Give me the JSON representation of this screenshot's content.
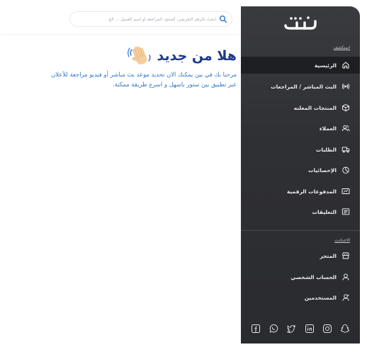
{
  "header": {
    "search_placeholder": "ابحث بالرقم التعريفي، المنتج، المراجعة أو اسم العميل ... الخ"
  },
  "welcome": {
    "title": "هلا من جديد",
    "line1": "مرحبا بك في بين يمكنك الان تحديد موعد بث مباشر أو فيديو مراجعة للأعلان",
    "line2": "عبر تطبيق بين ستور باسهل و اسرع طريقة ممكنة."
  },
  "sidebar": {
    "logo_text": "بين",
    "explore_label": "استكشف",
    "items": [
      {
        "label": "الرئيسية",
        "icon": "home-icon",
        "active": true
      },
      {
        "label": "البث المباشر / المراجعات",
        "icon": "broadcast-icon",
        "active": false
      },
      {
        "label": "المنتجات المعلنه",
        "icon": "box-icon",
        "active": false
      },
      {
        "label": "العملاء",
        "icon": "users-icon",
        "active": false
      },
      {
        "label": "الطلبات",
        "icon": "truck-icon",
        "active": false
      },
      {
        "label": "الإحصائيات",
        "icon": "pie-chart-icon",
        "active": false
      },
      {
        "label": "المدفوعات الرقمية",
        "icon": "payment-icon",
        "active": false
      },
      {
        "label": "التعليقات",
        "icon": "comments-icon",
        "active": false
      }
    ],
    "settings_label": "الاعدادت",
    "settings_items": [
      {
        "label": "المتجر",
        "icon": "store-icon"
      },
      {
        "label": "الحساب الشخصي",
        "icon": "user-icon"
      },
      {
        "label": "المستخدمين",
        "icon": "user-group-icon"
      }
    ],
    "socials": [
      "facebook-icon",
      "whatsapp-icon",
      "twitter-icon",
      "linkedin-icon",
      "instagram-icon",
      "snapchat-icon"
    ]
  },
  "colors": {
    "title": "#1d3b8b",
    "body_text": "#3575c8",
    "sidebar_bg": "#2f3034",
    "sidebar_active": "#1e1f22"
  }
}
